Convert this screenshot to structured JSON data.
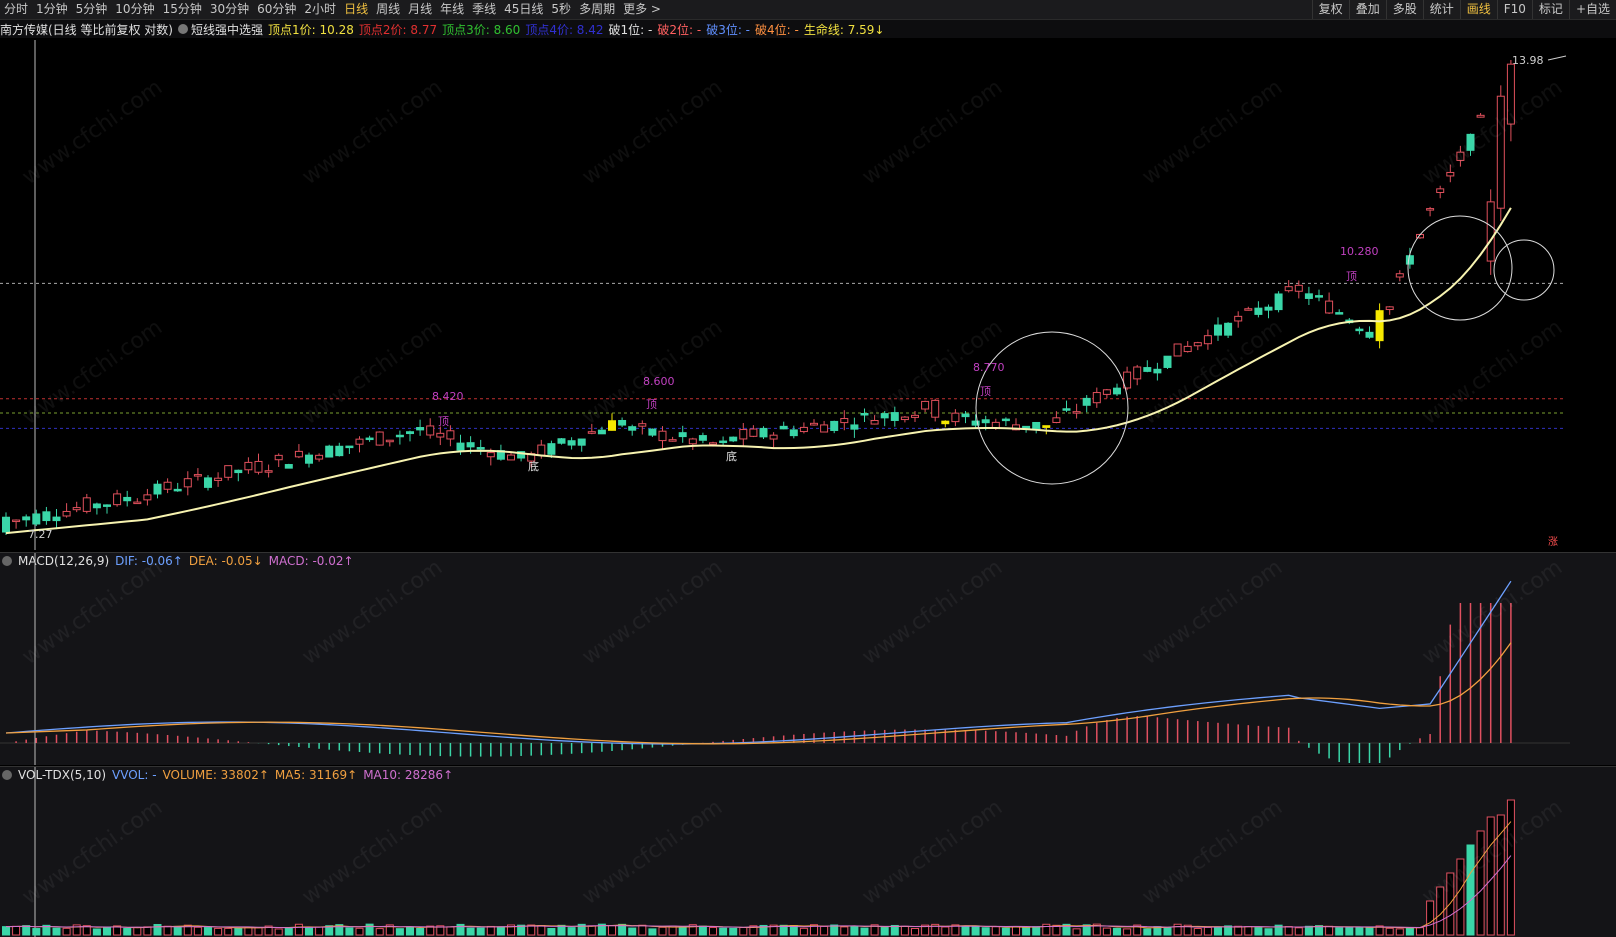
{
  "toolbar": {
    "periods": [
      "分时",
      "1分钟",
      "5分钟",
      "10分钟",
      "15分钟",
      "30分钟",
      "60分钟",
      "2小时",
      "日线",
      "周线",
      "月线",
      "年线",
      "季线",
      "45日线",
      "5秒",
      "多周期",
      "更多 >"
    ],
    "active_period": "日线",
    "right_items": [
      "复权",
      "叠加",
      "多股",
      "统计",
      "画线",
      "F10",
      "标记",
      "+自选"
    ]
  },
  "infobar": {
    "stock": "南方传媒(日线 等比前复权 对数)",
    "indicator": "短线强中选强",
    "items": [
      {
        "text": "顶点1价: 10.28",
        "color": "#f0e040"
      },
      {
        "text": "顶点2价: 8.77",
        "color": "#e03030"
      },
      {
        "text": "顶点3价: 8.60",
        "color": "#30c030"
      },
      {
        "text": "顶点4价: 8.42",
        "color": "#3030d0"
      },
      {
        "text": "破1位: -",
        "color": "#e0e0e0"
      },
      {
        "text": "破2位: -",
        "color": "#ff6060"
      },
      {
        "text": "破3位: -",
        "color": "#6090ff"
      },
      {
        "text": "破4位: -",
        "color": "#ff9040"
      },
      {
        "text": "生命线: 7.59↓",
        "color": "#f0e040"
      }
    ]
  },
  "main_chart": {
    "high_label": "13.98",
    "low_label": "7.27",
    "peak_labels": [
      "8.420",
      "8.600",
      "8.770",
      "10.280"
    ],
    "top_mark": "顶",
    "bottom_mark": "底",
    "rise_badge": "涨",
    "colors": {
      "up": "#e0505c",
      "down": "#3ad6a8",
      "special": "#f5e800",
      "lifeline": "#f7f3b0"
    }
  },
  "macd_panel": {
    "title": "MACD(12,26,9)",
    "dif": "DIF: -0.06↑",
    "dea": "DEA: -0.05↓",
    "macd": "MACD: -0.02↑"
  },
  "vol_panel": {
    "title": "VOL-TDX(5,10)",
    "vvol": "VVOL: -",
    "volume": "VOLUME: 33802↑",
    "ma5": "MA5: 31169↑",
    "ma10": "MA10: 28286↑"
  },
  "watermark": "www.cfchi.com"
}
